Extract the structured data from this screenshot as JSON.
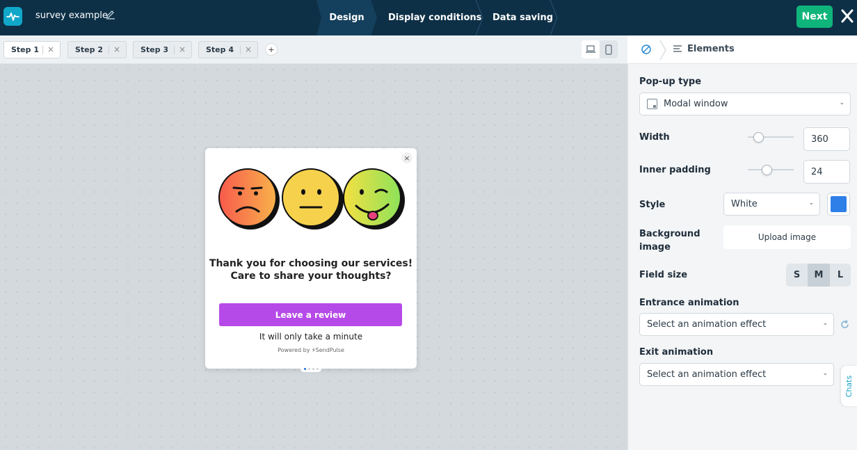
{
  "app": {
    "project_name": "survey example",
    "next_label": "Next"
  },
  "steps": [
    "Design",
    "Display conditions",
    "Data saving"
  ],
  "tabs": [
    "Step 1",
    "Step 2",
    "Step 3",
    "Step 4"
  ],
  "add_tab_label": "+",
  "popup": {
    "headline_line1": "Thank you for choosing our services!",
    "headline_line2": "Care to share your thoughts?",
    "cta_label": "Leave a review",
    "subtext": "It will only take a minute",
    "powered_by": "Powered by",
    "brand": "SendPulse",
    "close_glyph": "×",
    "page_dots": 4,
    "active_dot": 1,
    "cta_color": "#b64ae8"
  },
  "panel": {
    "header_title": "Elements",
    "popup_type_label": "Pop-up type",
    "popup_type_value": "Modal window",
    "width_label": "Width",
    "width_value": "360",
    "padding_label": "Inner padding",
    "padding_value": "24",
    "style_label": "Style",
    "style_value": "White",
    "style_color": "#2f7fe8",
    "bg_label_line1": "Background",
    "bg_label_line2": "image",
    "upload_label": "Upload image",
    "field_size_label": "Field size",
    "field_sizes": [
      "S",
      "M",
      "L"
    ],
    "field_size_selected": "M",
    "entrance_label": "Entrance animation",
    "entrance_placeholder": "Select an animation effect",
    "exit_label": "Exit animation",
    "exit_placeholder": "Select an animation effect"
  },
  "chats_label": "Chats",
  "colors": {
    "topbar": "#0e3047",
    "next": "#0fb47b",
    "accent": "#11a7c9"
  }
}
